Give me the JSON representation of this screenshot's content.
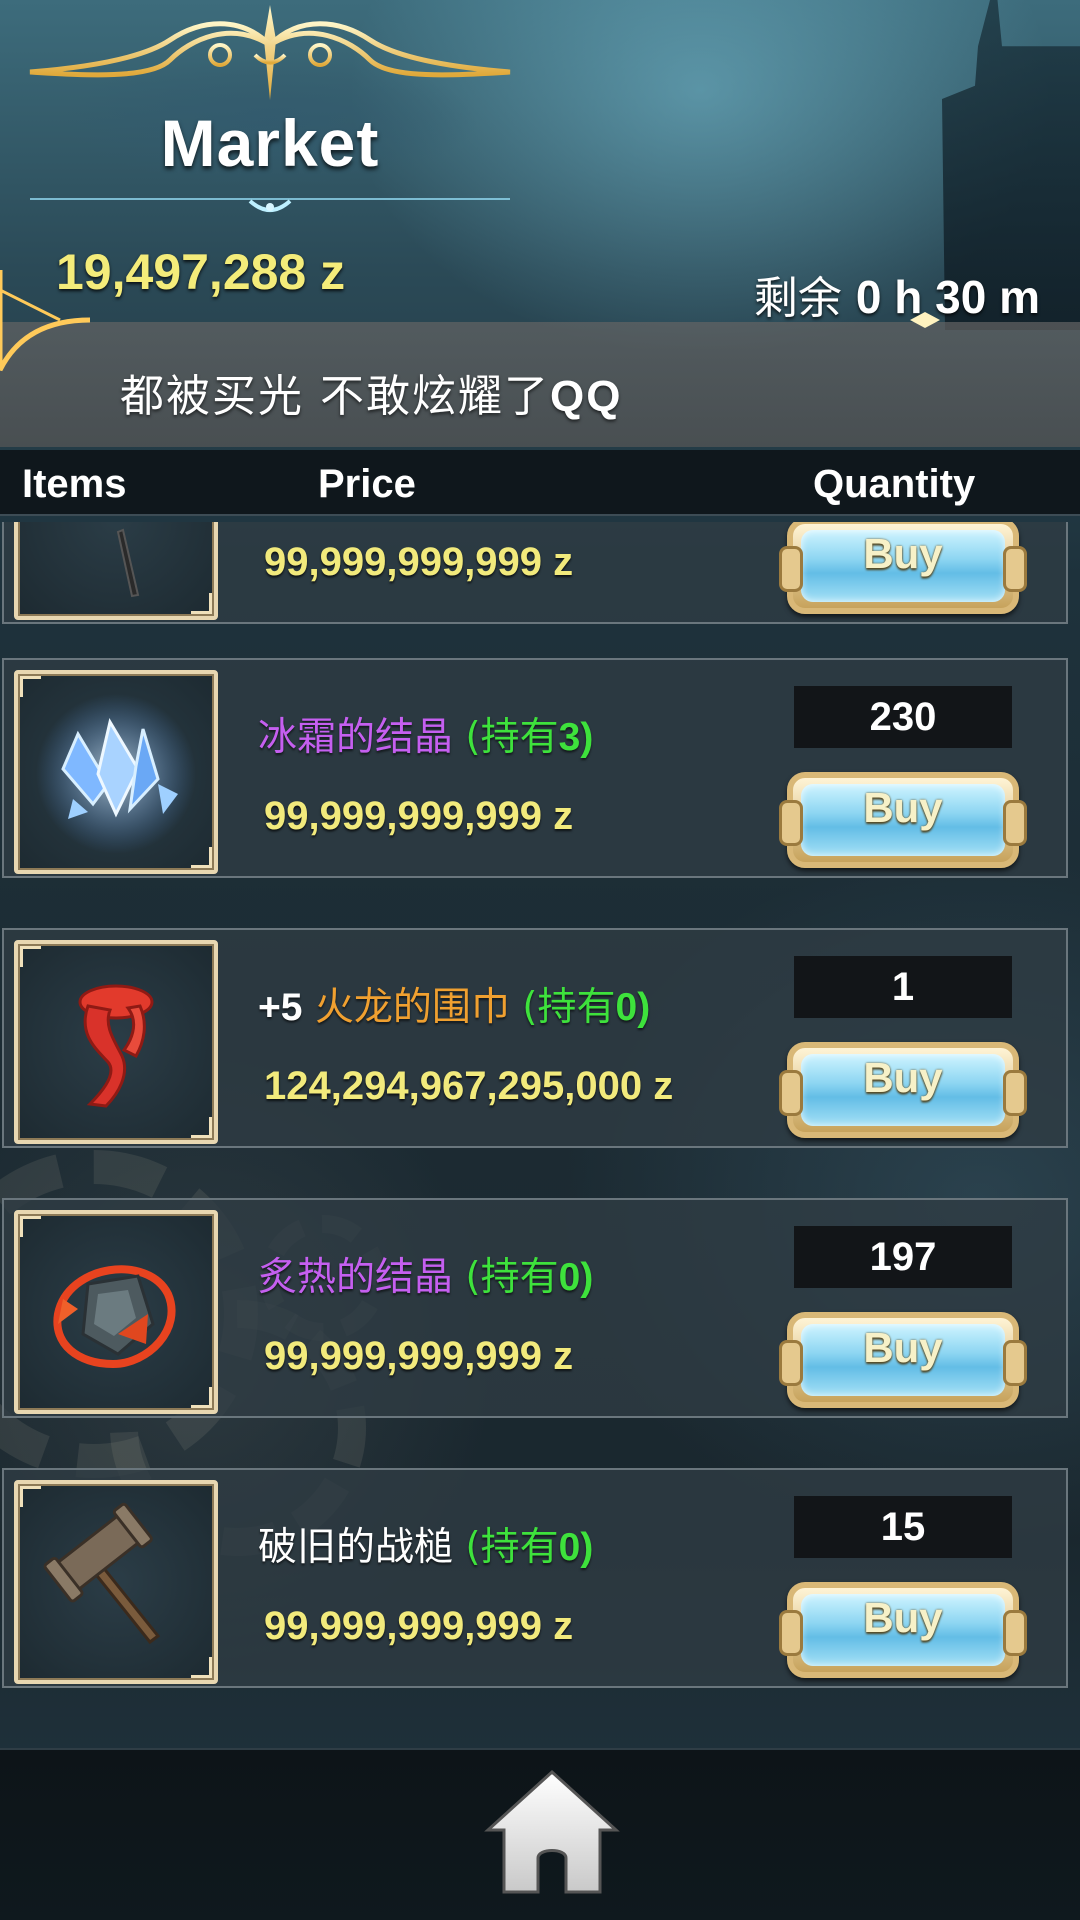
{
  "header": {
    "title": "Market",
    "money": "19,497,288 z",
    "timer_prefix": "剩余",
    "timer_value": "0 h 30 m",
    "banner_text_cn": "都被买光 不敢炫耀了",
    "banner_text_latin": "QQ"
  },
  "columns": {
    "items": "Items",
    "price": "Price",
    "quantity": "Quantity"
  },
  "rows": [
    {
      "plus": "",
      "name": "",
      "owned_prefix": "",
      "owned_count": "",
      "owned_suffix": "",
      "name_color": "#c55ff0",
      "price": "99,999,999,999 z",
      "quantity": "",
      "buy_label": "Buy",
      "icon": "dagger-icon"
    },
    {
      "plus": "",
      "name": "冰霜的结晶",
      "owned_prefix": "(持有",
      "owned_count": "3",
      "owned_suffix": ")",
      "name_color": "#c55ff0",
      "price": "99,999,999,999 z",
      "quantity": "230",
      "buy_label": "Buy",
      "icon": "ice-crystal-icon"
    },
    {
      "plus": "+5",
      "name": "火龙的围巾",
      "owned_prefix": "(持有",
      "owned_count": "0",
      "owned_suffix": ")",
      "name_color": "#f0a030",
      "price": "124,294,967,295,000 z",
      "quantity": "1",
      "buy_label": "Buy",
      "icon": "red-scarf-icon"
    },
    {
      "plus": "",
      "name": "炙热的结晶",
      "owned_prefix": "(持有",
      "owned_count": "0",
      "owned_suffix": ")",
      "name_color": "#c55ff0",
      "price": "99,999,999,999 z",
      "quantity": "197",
      "buy_label": "Buy",
      "icon": "fire-crystal-icon"
    },
    {
      "plus": "",
      "name": "破旧的战槌",
      "owned_prefix": "(持有",
      "owned_count": "0",
      "owned_suffix": ")",
      "name_color": "#ffffff",
      "price": "99,999,999,999 z",
      "quantity": "15",
      "buy_label": "Buy",
      "icon": "war-hammer-icon"
    }
  ],
  "footer": {
    "home_icon": "home-icon"
  },
  "colors": {
    "price": "#f2ea7c",
    "owned": "#3ee23c",
    "money": "#f4ec7a"
  }
}
